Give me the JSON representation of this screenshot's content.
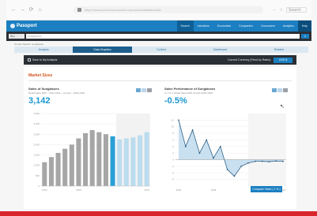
{
  "browser": {
    "nav": [
      "←",
      "→",
      "⟳",
      "⌂"
    ],
    "url": "https://www.portal.euromonitor.com/portal/statistics/tab",
    "right_icons": [
      "⋯",
      "☆"
    ],
    "search_placeholder": "Search"
  },
  "app": {
    "logo": "Passport",
    "nav": [
      "Search",
      "Industries",
      "Economies",
      "Companies",
      "Consumers",
      "Analytics",
      "Help"
    ],
    "active_nav": "Search"
  },
  "search": {
    "category": "ALL",
    "query": "sunglasses",
    "button": "⌕"
  },
  "breadcrumb": "Current Search: sunglasses",
  "tabs": [
    "Analysis",
    "Data Graphics",
    "Context",
    "Dashboard",
    "Related"
  ],
  "action_bar": {
    "save_label": "Save to My Analysis",
    "currency_label": "Convert Currency (Fixed by Rates):",
    "currency_value": "USD $"
  },
  "section_title": "Market Sizes",
  "cards": {
    "left": {
      "title": "Sales of Sunglasses",
      "subtitle": "Retail Value RSP - USD million - Current - 2003-2018",
      "value": "3,142"
    },
    "right": {
      "title": "Sales Performance of Sunglasses",
      "subtitle": "% Y-O-Y Retail Value RSP Growth 2003-2018",
      "value": "-0.5%"
    }
  },
  "colors": {
    "accent": "#1b7fc1",
    "value": "#1b97cf",
    "section": "#d0541e",
    "bar_hist": "#a6a6a6",
    "bar_current": "#2a9fd6",
    "bar_forecast": "#bcdcef"
  },
  "chart_data": [
    {
      "type": "bar",
      "title": "Sales of Sunglasses",
      "ylim": [
        0,
        3500
      ],
      "yticks": [
        "3,500",
        "3,000",
        "2,500",
        "2,000",
        "1,500",
        "1,000",
        "500",
        "0"
      ],
      "xticks": [
        "2003",
        "2008",
        "2018"
      ],
      "categories": [
        "2003",
        "2004",
        "2005",
        "2006",
        "2007",
        "2008",
        "2009",
        "2010",
        "2011",
        "2012",
        "2013",
        "2014",
        "2015",
        "2016",
        "2017",
        "2018"
      ],
      "values": [
        1150,
        1400,
        1600,
        1800,
        2000,
        2300,
        2550,
        2700,
        2600,
        2500,
        2400,
        2250,
        2300,
        2350,
        2450,
        2600
      ]
    },
    {
      "type": "area",
      "title": "Sales Performance of Sunglasses",
      "ylim": [
        -8,
        14
      ],
      "yticks": [
        "12",
        "10",
        "8",
        "6",
        "4",
        "2",
        "0",
        "-2",
        "-4",
        "-6"
      ],
      "xticks": [
        "2003",
        "2008",
        "2018"
      ],
      "x": [
        "2003",
        "2004",
        "2005",
        "2006",
        "2007",
        "2008",
        "2009",
        "2010",
        "2011",
        "2012",
        "2013",
        "2014",
        "2015",
        "2016",
        "2017",
        "2018"
      ],
      "values": [
        12,
        4,
        9,
        2,
        6,
        0.5,
        4,
        -3,
        -5,
        -2,
        -1,
        -0.5,
        -0.5,
        -0.6,
        -0.4,
        -0.5
      ]
    }
  ],
  "compare_button": "Compare Years ( 1 % )"
}
